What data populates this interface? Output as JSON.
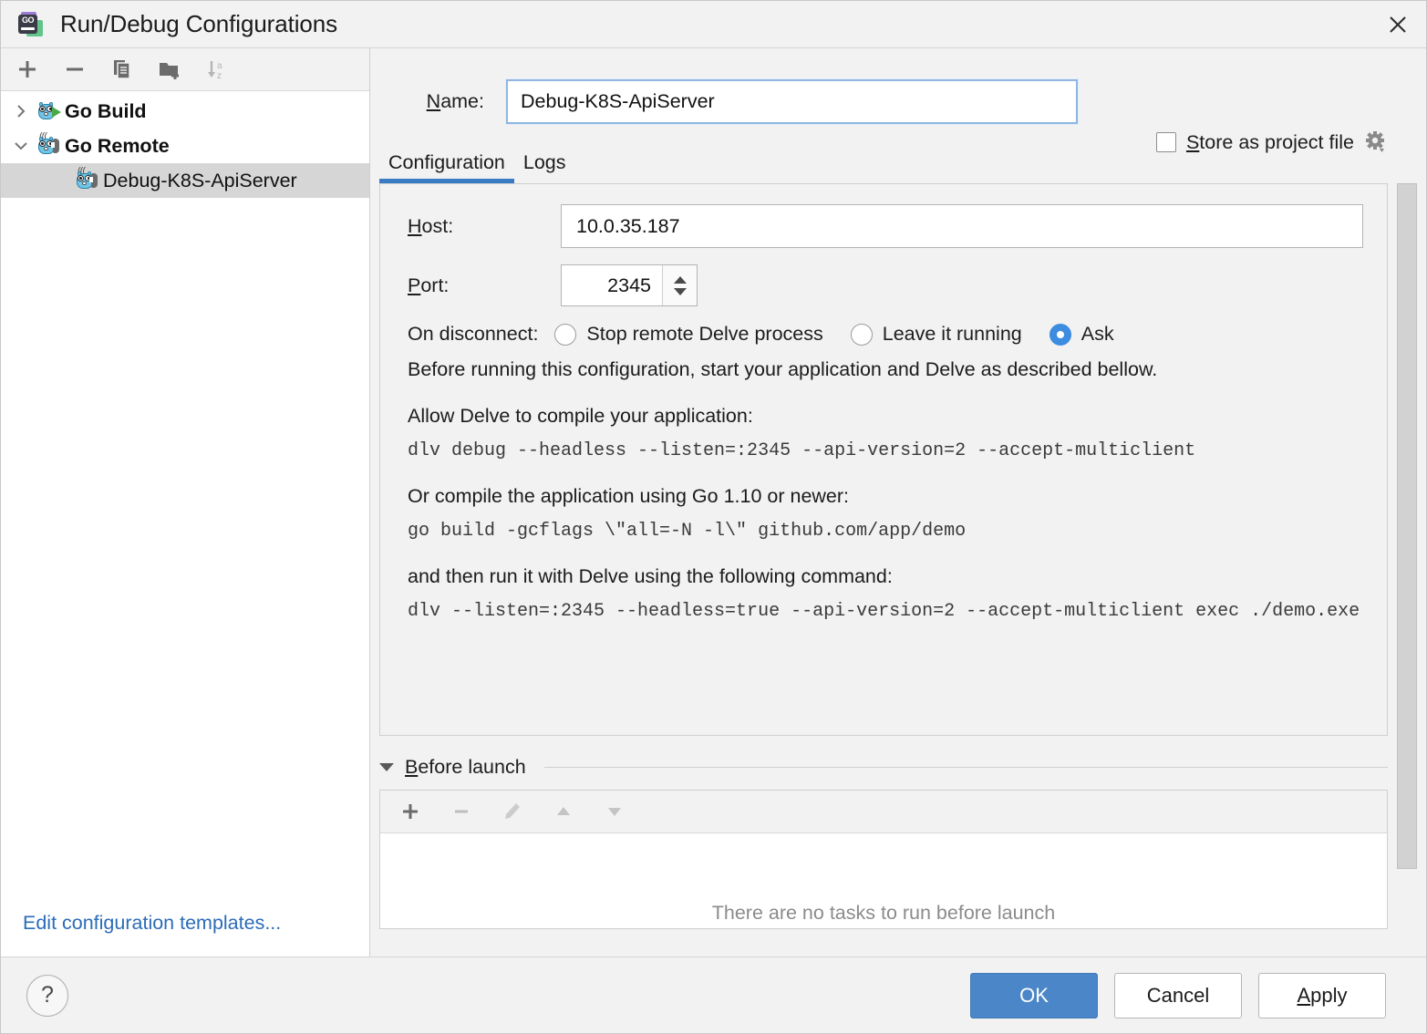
{
  "window": {
    "title": "Run/Debug Configurations",
    "app_icon": "goland-logo-icon",
    "go_badge": "GO",
    "close_icon": "close-icon"
  },
  "sidebar": {
    "toolbar": [
      {
        "name": "add-configuration-button",
        "icon": "plus-icon",
        "label": "+"
      },
      {
        "name": "remove-configuration-button",
        "icon": "minus-icon",
        "label": "−"
      },
      {
        "name": "copy-configuration-button",
        "icon": "copy-icon",
        "label": "Copy"
      },
      {
        "name": "new-folder-button",
        "icon": "folder-add-icon",
        "label": "New Folder"
      },
      {
        "name": "sort-configurations-button",
        "icon": "sort-az-icon",
        "label": "Sort"
      }
    ],
    "tree": [
      {
        "label": "Go Build",
        "icon": "go-build-icon",
        "expanded": false,
        "twisty": "chevron-right-icon",
        "level": 0,
        "selected": false
      },
      {
        "label": "Go Remote",
        "icon": "go-remote-icon",
        "expanded": true,
        "twisty": "chevron-down-icon",
        "level": 0,
        "selected": false
      },
      {
        "label": "Debug-K8S-ApiServer",
        "icon": "go-remote-icon",
        "expanded": null,
        "twisty": "",
        "level": 1,
        "selected": true
      }
    ],
    "edit_templates_link": "Edit configuration templates..."
  },
  "main": {
    "name_label": "Name:",
    "name_value": "Debug-K8S-ApiServer",
    "store_as_project_file": {
      "label": "Store as project file",
      "checked": false,
      "gear_icon": "gear-icon"
    },
    "tabs": [
      {
        "label": "Configuration",
        "active": true
      },
      {
        "label": "Logs",
        "active": false
      }
    ],
    "host_label": "Host:",
    "host_value": "10.0.35.187",
    "port_label": "Port:",
    "port_value": "2345",
    "on_disconnect": {
      "label": "On disconnect:",
      "options": [
        {
          "label": "Stop remote Delve process",
          "selected": false
        },
        {
          "label": "Leave it running",
          "selected": false
        },
        {
          "label": "Ask",
          "selected": true
        }
      ]
    },
    "description": {
      "intro": "Before running this configuration, start your application and Delve as described bellow.",
      "heading_1": "Allow Delve to compile your application:",
      "code_1": "dlv debug --headless --listen=:2345 --api-version=2 --accept-multiclient",
      "heading_2": "Or compile the application using Go 1.10 or newer:",
      "code_2": "go build -gcflags \\\"all=-N -l\\\" github.com/app/demo",
      "heading_3": "and then run it with Delve using the following command:",
      "code_3": "dlv --listen=:2345 --headless=true --api-version=2 --accept-multiclient exec ./demo.exe"
    },
    "before_launch": {
      "title": "Before launch",
      "expanded": true,
      "toolbar": [
        {
          "name": "add-task-button",
          "icon": "plus-icon"
        },
        {
          "name": "remove-task-button",
          "icon": "minus-icon"
        },
        {
          "name": "edit-task-button",
          "icon": "pencil-icon"
        },
        {
          "name": "move-task-up-button",
          "icon": "triangle-up-icon"
        },
        {
          "name": "move-task-down-button",
          "icon": "triangle-down-icon"
        }
      ],
      "empty_text": "There are no tasks to run before launch"
    }
  },
  "footer": {
    "help_label": "?",
    "ok_label": "OK",
    "cancel_label": "Cancel",
    "apply_label": "Apply"
  },
  "colors": {
    "accent_blue": "#3a7cc4",
    "primary_button": "#4a86c8",
    "link_blue": "#2b6cb8",
    "window_bg": "#f2f2f2",
    "selection_gray": "#d6d6d6"
  }
}
